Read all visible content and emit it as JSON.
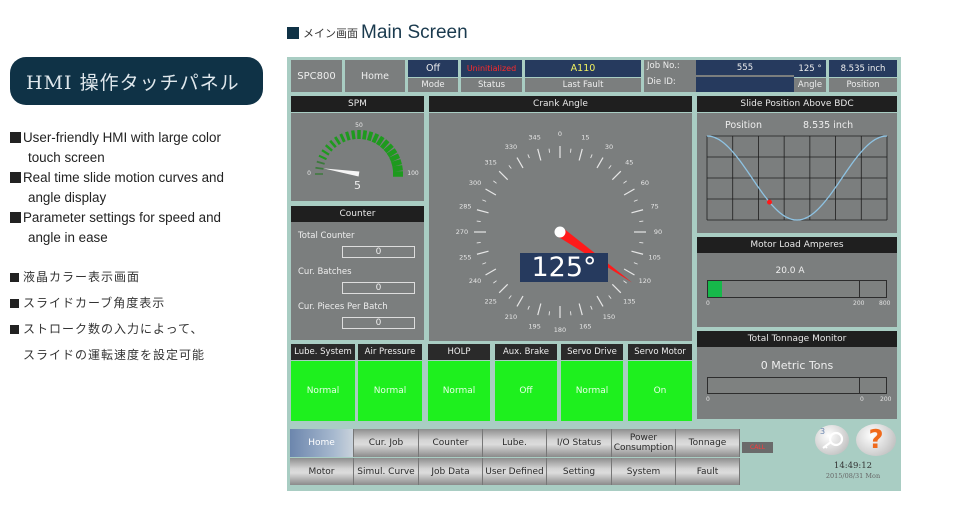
{
  "promo": {
    "badge": "HMI 操作タッチパネル",
    "features_en": [
      {
        "line1": "User-friendly HMI with large color",
        "line2": "touch screen"
      },
      {
        "line1": "Real time slide motion curves and",
        "line2": "angle display"
      },
      {
        "line1": "Parameter settings for speed and",
        "line2": "angle in ease"
      }
    ],
    "features_jp": [
      "液晶カラー表示画面",
      "スライドカーブ角度表示",
      "ストローク数の入力によって、",
      "スライドの運転速度を設定可能"
    ]
  },
  "screen_title": {
    "jp": "メイン画面",
    "en": "Main Screen"
  },
  "topbar": {
    "model": "SPC800",
    "home": "Home",
    "mode_value": "Off",
    "mode_label": "Mode",
    "status_value": "Uninitialized",
    "status_label": "Status",
    "last_fault_value": "A110",
    "last_fault_label": "Last Fault",
    "job_no_label": "Job No.:",
    "job_no_value": "555",
    "die_id_label": "Die ID:",
    "die_id_value": "",
    "angle_value": "125 °",
    "angle_label": "Angle",
    "position_value": "8.535 inch",
    "position_label": "Position"
  },
  "spm": {
    "title": "SPM",
    "value": "5",
    "min_label": "0",
    "mid_label": "50",
    "max_label": "100",
    "value_num": 5,
    "range": [
      0,
      100
    ]
  },
  "counter": {
    "title": "Counter",
    "total_label": "Total Counter",
    "total_value": "0",
    "batches_label": "Cur. Batches",
    "batches_value": "0",
    "pieces_label": "Cur. Pieces Per Batch",
    "pieces_value": "0"
  },
  "crank": {
    "title": "Crank Angle",
    "value_display": "125°",
    "angle_deg": 125,
    "tick_labels": [
      "0",
      "15",
      "30",
      "45",
      "60",
      "75",
      "90",
      "105",
      "120",
      "135",
      "150",
      "165",
      "180",
      "195",
      "210",
      "225",
      "240",
      "255",
      "270",
      "285",
      "300",
      "315",
      "330",
      "345"
    ]
  },
  "slide": {
    "title": "Slide Position Above BDC",
    "position_label": "Position",
    "position_value": "8.535 inch",
    "marker_angle_deg": 125
  },
  "motor": {
    "title": "Motor Load Amperes",
    "value_text": "20.0 A",
    "fill_fraction": 0.08,
    "scale_labels": [
      "0",
      "200",
      "800"
    ]
  },
  "tonnage": {
    "title": "Total Tonnage Monitor",
    "value_text": "0 Metric Tons",
    "fill_fraction": 0,
    "scale_labels": [
      "0",
      "0",
      "200"
    ]
  },
  "status_tiles": [
    {
      "label": "Lube. System",
      "value": "Normal"
    },
    {
      "label": "Air Pressure",
      "value": "Normal"
    },
    {
      "label": "HOLP",
      "value": "Normal"
    },
    {
      "label": "Aux. Brake",
      "value": "Off"
    },
    {
      "label": "Servo Drive",
      "value": "Normal"
    },
    {
      "label": "Servo Motor",
      "value": "On"
    }
  ],
  "nav_row1": [
    "Home",
    "Cur. Job",
    "Counter",
    "Lube.",
    "I/O Status",
    "Power Consumption",
    "Tonnage"
  ],
  "nav_row2": [
    "Motor",
    "Simul. Curve",
    "Job Data",
    "User Defined",
    "Setting",
    "System",
    "Fault"
  ],
  "alarm_indicator": "CALL",
  "key_level": "3",
  "clock": {
    "time": "14:49:12",
    "date": "2015/08/31 Mon"
  },
  "colors": {
    "accent_navy": "#263a5e",
    "status_green": "#1ef01e",
    "needle_red": "#ff1a1a",
    "frame": "#a9cdc3"
  }
}
